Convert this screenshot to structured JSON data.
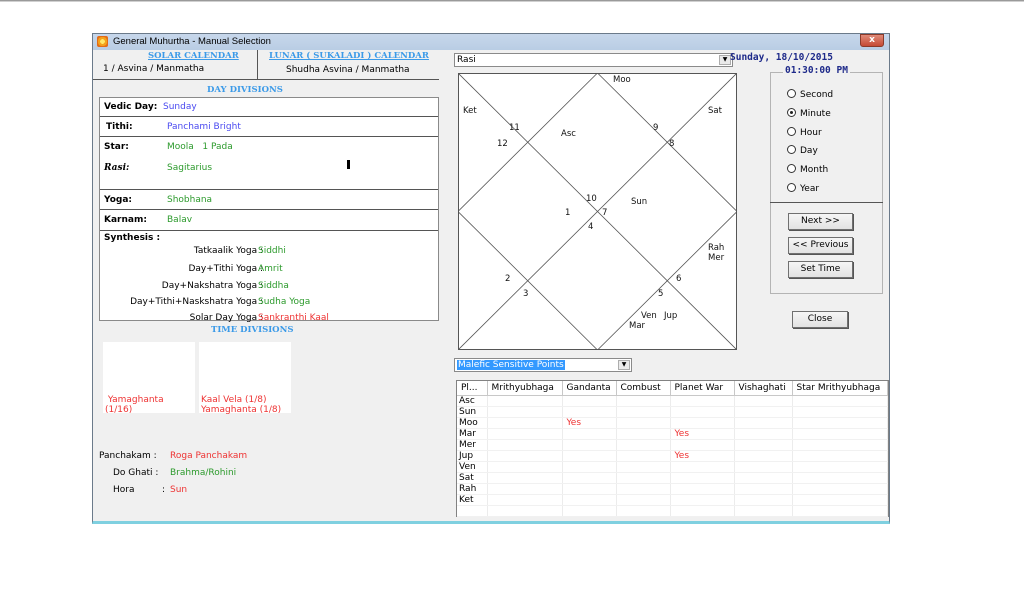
{
  "window": {
    "title": "General Muhurtha - Manual Selection",
    "close_label": "x"
  },
  "calendar": {
    "solar_heading": "SOLAR CALENDAR",
    "solar_value": "1 / Asvina / Manmatha",
    "lunar_heading": "LUNAR ( SUKALADI ) CALENDAR",
    "lunar_value": "Shudha Asvina / Manmatha"
  },
  "day_divisions": {
    "heading": "DAY DIVISIONS",
    "vedic_day": {
      "label": "Vedic Day:",
      "value": "Sunday"
    },
    "tithi": {
      "label": "Tithi:",
      "value": "Panchami Bright"
    },
    "star": {
      "label": "Star:",
      "value": "Moola   1 Pada"
    },
    "rasi": {
      "label": "Rasi:",
      "value": "Sagitarius"
    },
    "yoga": {
      "label": "Yoga:",
      "value": "Shobhana"
    },
    "karnam": {
      "label": "Karnam:",
      "value": "Balav"
    },
    "synthesis": {
      "label": "Synthesis :",
      "items": [
        {
          "label": "Tatkaalik Yoga :",
          "value": "Siddhi",
          "color": "green"
        },
        {
          "label": "Day+Tithi Yoga :",
          "value": "Amrit",
          "color": "green"
        },
        {
          "label": "Day+Nakshatra Yoga :",
          "value": "Siddha",
          "color": "green"
        },
        {
          "label": "Day+Tithi+Naskshatra Yoga :",
          "value": "Sudha Yoga",
          "color": "green"
        },
        {
          "label": "Solar Day Yoga :",
          "value": "Sankranthi Kaal",
          "color": "red"
        }
      ]
    }
  },
  "time_divisions": {
    "heading": "TIME DIVISIONS",
    "boxes": [
      {
        "text": " Yamaghanta\n(1/16)"
      },
      {
        "text": "Kaal Vela (1/8)\nYamaghanta (1/8)"
      }
    ],
    "panchakam": {
      "label": "Panchakam :",
      "value": "Roga Panchakam"
    },
    "do_ghati": {
      "label": "Do Ghati :",
      "value": "Brahma/Rohini"
    },
    "hora": {
      "label": "Hora",
      "sep": ":",
      "value": "Sun"
    }
  },
  "chart_selector": {
    "value": "Rasi"
  },
  "rasi_chart": {
    "house_numbers": [
      "1",
      "2",
      "3",
      "4",
      "5",
      "6",
      "7",
      "8",
      "9",
      "10",
      "11",
      "12"
    ],
    "planets": {
      "asc": "Asc",
      "moo": "Moo",
      "ket": "Ket",
      "sat": "Sat",
      "sun": "Sun",
      "rah": "Rah",
      "mer": "Mer",
      "ven": "Ven",
      "jup": "Jup",
      "mar": "Mar"
    }
  },
  "datetime": {
    "date": "Sunday, 18/10/2015",
    "time": "01:30:00 PM"
  },
  "step_options": [
    {
      "label": "Second",
      "selected": false
    },
    {
      "label": "Minute",
      "selected": true
    },
    {
      "label": "Hour",
      "selected": false
    },
    {
      "label": "Day",
      "selected": false
    },
    {
      "label": "Month",
      "selected": false
    },
    {
      "label": "Year",
      "selected": false
    }
  ],
  "buttons": {
    "next": "Next >>",
    "previous": "<< Previous",
    "set_time": "Set Time",
    "close": "Close"
  },
  "points_selector": {
    "value": "Malefic Sensitive Points"
  },
  "grid": {
    "columns": [
      "Pl...",
      "Mrithyubhaga",
      "Gandanta",
      "Combust",
      "Planet War",
      "Vishaghati",
      "Star Mrithyubhaga"
    ],
    "rows": [
      [
        "Asc",
        "",
        "",
        "",
        "",
        "",
        ""
      ],
      [
        "Sun",
        "",
        "",
        "",
        "",
        "",
        ""
      ],
      [
        "Moo",
        "",
        "Yes",
        "",
        "",
        "",
        ""
      ],
      [
        "Mar",
        "",
        "",
        "",
        "Yes",
        "",
        ""
      ],
      [
        "Mer",
        "",
        "",
        "",
        "",
        "",
        ""
      ],
      [
        "Jup",
        "",
        "",
        "",
        "Yes",
        "",
        ""
      ],
      [
        "Ven",
        "",
        "",
        "",
        "",
        "",
        ""
      ],
      [
        "Sat",
        "",
        "",
        "",
        "",
        "",
        ""
      ],
      [
        "Rah",
        "",
        "",
        "",
        "",
        "",
        ""
      ],
      [
        "Ket",
        "",
        "",
        "",
        "",
        "",
        ""
      ],
      [
        "",
        "",
        "",
        "",
        "",
        "",
        ""
      ]
    ]
  },
  "colors": {
    "heading_blue": "#3b9ae8",
    "value_blue": "#4a4af0",
    "value_green": "#2c9a2c",
    "value_red": "#ee3333",
    "date_navy": "#1e2a8a"
  }
}
